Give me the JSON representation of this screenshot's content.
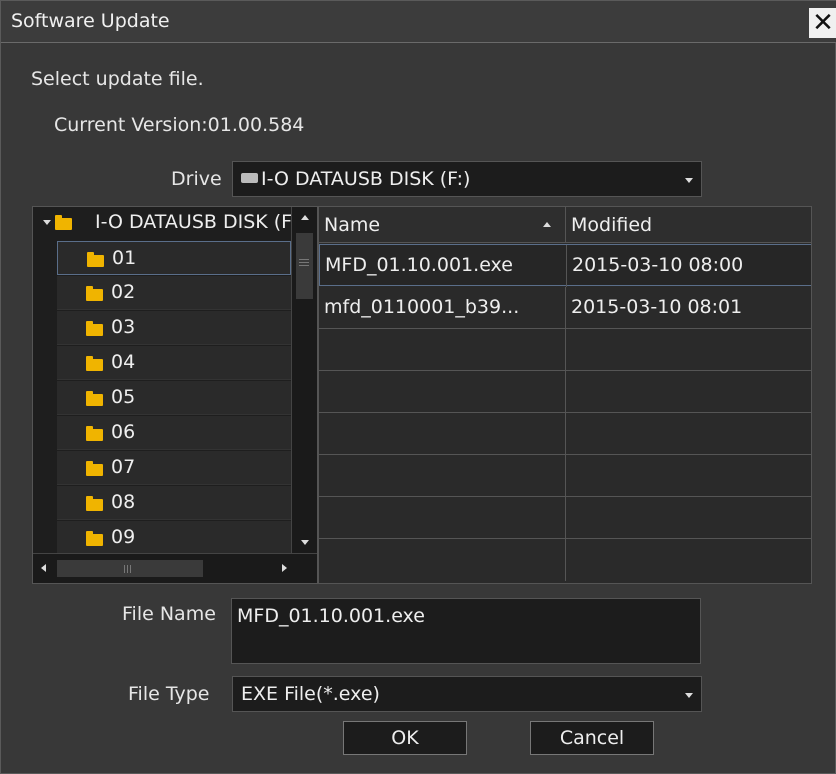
{
  "window": {
    "title": "Software Update",
    "close_glyph": "✕"
  },
  "instructions": "Select update file.",
  "current_version": "Current Version:01.00.584",
  "drive": {
    "label": "Drive",
    "value": "I-O DATAUSB DISK (F:)",
    "icon": "drive-icon"
  },
  "tree": {
    "root_label": "I-O DATAUSB DISK (F:)",
    "items": [
      {
        "label": "01",
        "selected": true
      },
      {
        "label": "02"
      },
      {
        "label": "03"
      },
      {
        "label": "04"
      },
      {
        "label": "05"
      },
      {
        "label": "06"
      },
      {
        "label": "07"
      },
      {
        "label": "08"
      },
      {
        "label": "09"
      }
    ]
  },
  "files": {
    "columns": {
      "name": "Name",
      "modified": "Modified"
    },
    "rows": [
      {
        "name": "MFD_01.10.001.exe",
        "modified": "2015-03-10 08:00",
        "selected": true
      },
      {
        "name": "mfd_0110001_b39...",
        "modified": "2015-03-10 08:01"
      }
    ]
  },
  "file_name": {
    "label": "File Name",
    "value": "MFD_01.10.001.exe"
  },
  "file_type": {
    "label": "File Type",
    "value": "EXE File(*.exe)"
  },
  "buttons": {
    "ok": "OK",
    "cancel": "Cancel"
  },
  "colors": {
    "folder": "#f0b400",
    "selection_border": "#5a6e8a",
    "background": "#383838",
    "field": "#1c1c1c"
  }
}
